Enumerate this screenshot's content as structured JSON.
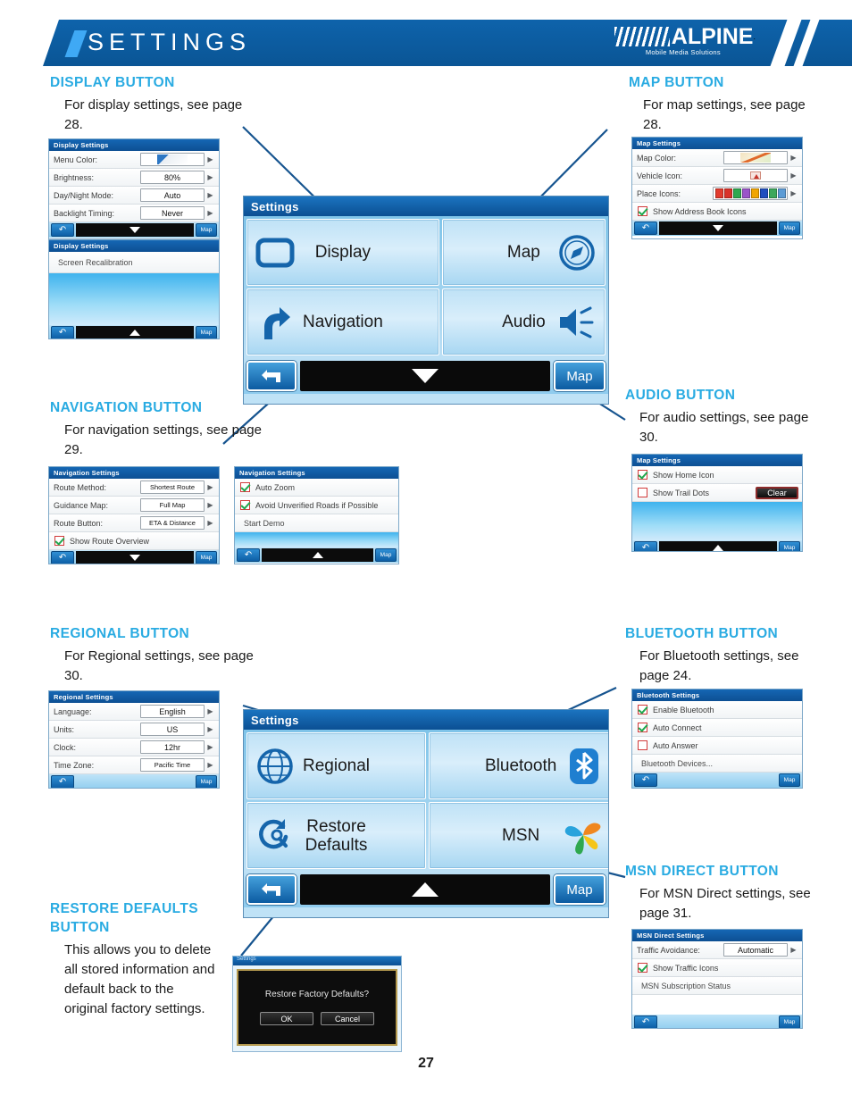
{
  "header": {
    "title": "SETTINGS",
    "logo_word": "ALPINE",
    "logo_reg": ".",
    "logo_sub": "Mobile Media Solutions"
  },
  "page_number": "27",
  "callouts": [
    {
      "title": "DISPLAY BUTTON",
      "body": "For display settings, see page 28."
    },
    {
      "title": "MAP BUTTON",
      "body": "For map settings, see page 28."
    },
    {
      "title": "NAVIGATION BUTTON",
      "body": "For navigation settings, see page 29."
    },
    {
      "title": "AUDIO BUTTON",
      "body": "For audio settings, see page 30."
    },
    {
      "title": "REGIONAL BUTTON",
      "body": "For Regional settings, see page 30."
    },
    {
      "title": "BLUETOOTH BUTTON",
      "body": "For Bluetooth settings, see page 24."
    },
    {
      "title": "RESTORE DEFAULTS BUTTON",
      "body": "This allows you to delete all stored information and default back to the original factory settings."
    },
    {
      "title": "MSN DIRECT BUTTON",
      "body": "For MSN Direct settings, see page 31."
    }
  ],
  "display_settings_1": {
    "title": "Display Settings",
    "rows": [
      {
        "label": "Menu Color:",
        "value": ""
      },
      {
        "label": "Brightness:",
        "value": "80%"
      },
      {
        "label": "Day/Night Mode:",
        "value": "Auto"
      },
      {
        "label": "Backlight Timing:",
        "value": "Never"
      }
    ],
    "back": "↶",
    "map": "Map"
  },
  "display_settings_2": {
    "title": "Display Settings",
    "item": "Screen Recalibration",
    "map": "Map"
  },
  "map_settings_1": {
    "title": "Map Settings",
    "rows": [
      {
        "label": "Map Color:",
        "value": ""
      },
      {
        "label": "Vehicle Icon:",
        "value": ""
      },
      {
        "label": "Place Icons:",
        "value": ""
      }
    ],
    "check": {
      "label": "Show Address Book Icons",
      "checked": true
    },
    "map": "Map"
  },
  "settings_main_1": {
    "title": "Settings",
    "tiles": [
      {
        "label": "Display",
        "icon": "rounded-rect-icon",
        "icon_side": "left"
      },
      {
        "label": "Map",
        "icon": "compass-icon",
        "icon_side": "right"
      },
      {
        "label": "Navigation",
        "icon": "turn-arrow-icon",
        "icon_side": "left"
      },
      {
        "label": "Audio",
        "icon": "speaker-icon",
        "icon_side": "right"
      }
    ],
    "map": "Map"
  },
  "settings_main_2": {
    "title": "Settings",
    "tiles": [
      {
        "label": "Regional",
        "icon": "globe-icon",
        "icon_side": "left"
      },
      {
        "label": "Bluetooth",
        "icon": "bluetooth-icon",
        "icon_side": "right"
      },
      {
        "label": "Restore\nDefaults",
        "icon": "restore-wrench-icon",
        "icon_side": "left"
      },
      {
        "label": "MSN",
        "icon": "msn-butterfly-icon",
        "icon_side": "right"
      }
    ],
    "map": "Map"
  },
  "navigation_settings_1": {
    "title": "Navigation Settings",
    "rows": [
      {
        "label": "Route Method:",
        "value": "Shortest Route"
      },
      {
        "label": "Guidance Map:",
        "value": "Full Map"
      },
      {
        "label": "Route Button:",
        "value": "ETA & Distance"
      }
    ],
    "check": {
      "label": "Show Route Overview",
      "checked": true
    },
    "map": "Map"
  },
  "navigation_settings_2": {
    "title": "Navigation Settings",
    "checks": [
      {
        "label": "Auto Zoom",
        "checked": true
      },
      {
        "label": "Avoid Unverified Roads if Possible",
        "checked": true
      }
    ],
    "plain": "Start Demo",
    "map": "Map"
  },
  "map_settings_2": {
    "title": "Map Settings",
    "checks": [
      {
        "label": "Show Home Icon",
        "checked": true
      },
      {
        "label": "Show Trail Dots",
        "checked": false
      }
    ],
    "clear_button": "Clear",
    "map": "Map"
  },
  "regional_settings": {
    "title": "Regional Settings",
    "rows": [
      {
        "label": "Language:",
        "value": "English"
      },
      {
        "label": "Units:",
        "value": "US"
      },
      {
        "label": "Clock:",
        "value": "12hr"
      },
      {
        "label": "Time Zone:",
        "value": "Pacific Time"
      }
    ],
    "map": "Map"
  },
  "bluetooth_settings": {
    "title": "Bluetooth Settings",
    "checks": [
      {
        "label": "Enable Bluetooth",
        "checked": true
      },
      {
        "label": "Auto Connect",
        "checked": true
      },
      {
        "label": "Auto Answer",
        "checked": false
      }
    ],
    "plain": "Bluetooth Devices...",
    "map": "Map"
  },
  "msn_settings": {
    "title": "MSN Direct Settings",
    "rows": [
      {
        "label": "Traffic Avoidance:",
        "value": "Automatic"
      }
    ],
    "check": {
      "label": "Show Traffic Icons",
      "checked": true
    },
    "plain": "MSN Subscription Status",
    "map": "Map"
  },
  "restore_dialog": {
    "title": "Settings",
    "message": "Restore Factory Defaults?",
    "ok": "OK",
    "cancel": "Cancel"
  },
  "colors": {
    "brand_blue": "#0a5ca0",
    "accent_cyan": "#29abe2",
    "text_dark": "#1a1a1a"
  }
}
